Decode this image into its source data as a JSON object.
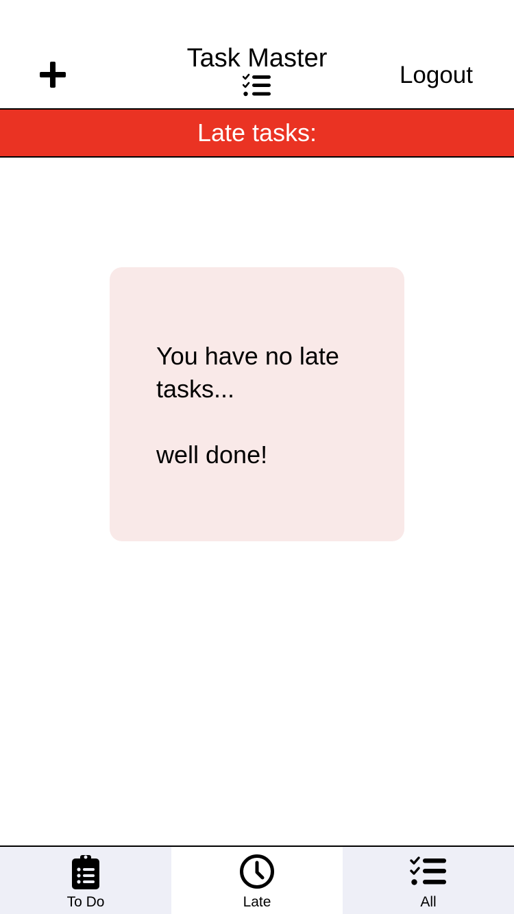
{
  "header": {
    "add_icon": "plus-icon",
    "title": "Task Master",
    "title_icon": "checklist-icon",
    "logout_label": "Logout"
  },
  "banner": {
    "label": "Late tasks:",
    "color": "#ea3323"
  },
  "card": {
    "line1": "You have no late tasks...",
    "line2": "well done!",
    "background": "#f9e9e8"
  },
  "tabs": [
    {
      "label": "To Do",
      "icon": "clipboard-list-icon",
      "active": false
    },
    {
      "label": "Late",
      "icon": "clock-icon",
      "active": true
    },
    {
      "label": "All",
      "icon": "checklist-icon",
      "active": false
    }
  ]
}
